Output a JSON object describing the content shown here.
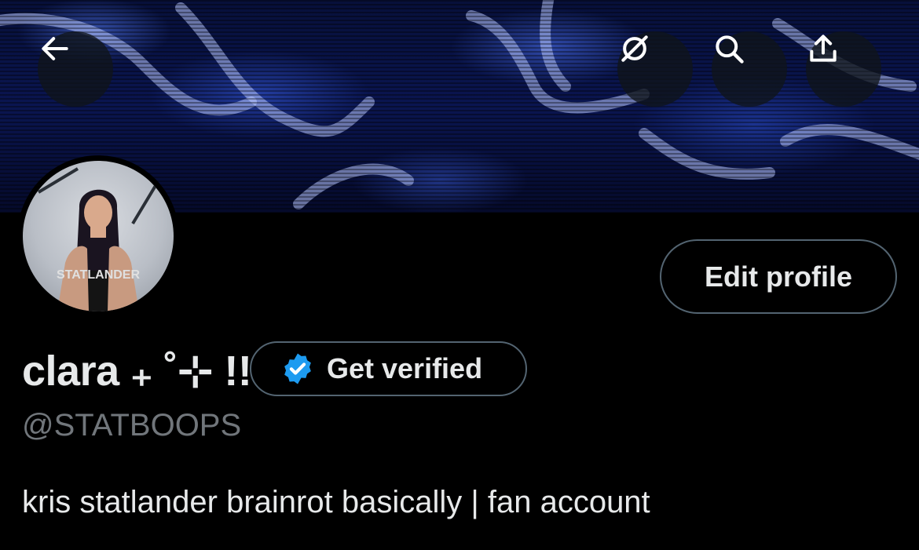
{
  "header": {
    "back_icon": "arrow-left-icon",
    "actions": [
      {
        "name": "grok-icon"
      },
      {
        "name": "search-icon"
      },
      {
        "name": "share-icon"
      }
    ]
  },
  "profile": {
    "display_name": "clara ₊ ˚⊹ !!",
    "handle": "@STATBOOPS",
    "bio": "kris statlander brainrot basically | fan account",
    "edit_label": "Edit profile",
    "verify_label": "Get verified"
  },
  "colors": {
    "verified_badge": "#1d9bf0",
    "text_primary": "#e7e9ea",
    "text_secondary": "#71767b",
    "border": "#536471"
  }
}
